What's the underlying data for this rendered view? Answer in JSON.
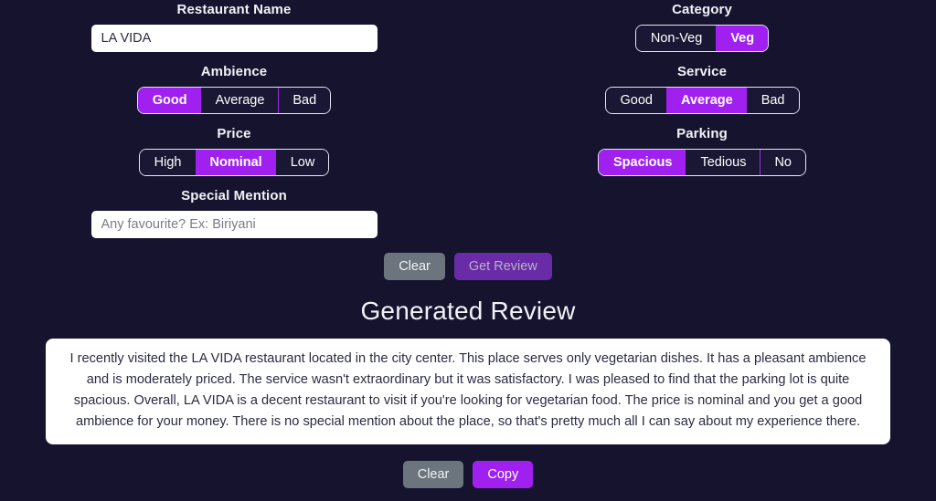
{
  "fields": {
    "restaurant_name": {
      "label": "Restaurant Name",
      "value": "LA VIDA",
      "placeholder": ""
    },
    "category": {
      "label": "Category",
      "options": [
        "Non-Veg",
        "Veg"
      ],
      "selected": "Veg"
    },
    "ambience": {
      "label": "Ambience",
      "options": [
        "Good",
        "Average",
        "Bad"
      ],
      "selected": "Good"
    },
    "service": {
      "label": "Service",
      "options": [
        "Good",
        "Average",
        "Bad"
      ],
      "selected": "Average"
    },
    "price": {
      "label": "Price",
      "options": [
        "High",
        "Nominal",
        "Low"
      ],
      "selected": "Nominal"
    },
    "parking": {
      "label": "Parking",
      "options": [
        "Spacious",
        "Tedious",
        "No"
      ],
      "selected": "Spacious"
    },
    "special_mention": {
      "label": "Special Mention",
      "value": "",
      "placeholder": "Any favourite? Ex: Biriyani"
    }
  },
  "actions": {
    "clear_label": "Clear",
    "get_review_label": "Get Review"
  },
  "review": {
    "heading": "Generated Review",
    "text": "I recently visited the LA VIDA restaurant located in the city center. This place serves only vegetarian dishes. It has a pleasant ambience and is moderately priced. The service wasn't extraordinary but it was satisfactory. I was pleased to find that the parking lot is quite spacious. Overall, LA VIDA is a decent restaurant to visit if you're looking for vegetarian food. The price is nominal and you get a good ambience for your money. There is no special mention about the place, so that's pretty much all I can say about my experience there.",
    "clear_label": "Clear",
    "copy_label": "Copy"
  },
  "colors": {
    "background": "#15132e",
    "accent": "#a021ef",
    "accent_muted": "#6a2ba8",
    "clear_gray": "#6c757d",
    "card": "#ffffff",
    "text_light": "#f2f2f7"
  }
}
